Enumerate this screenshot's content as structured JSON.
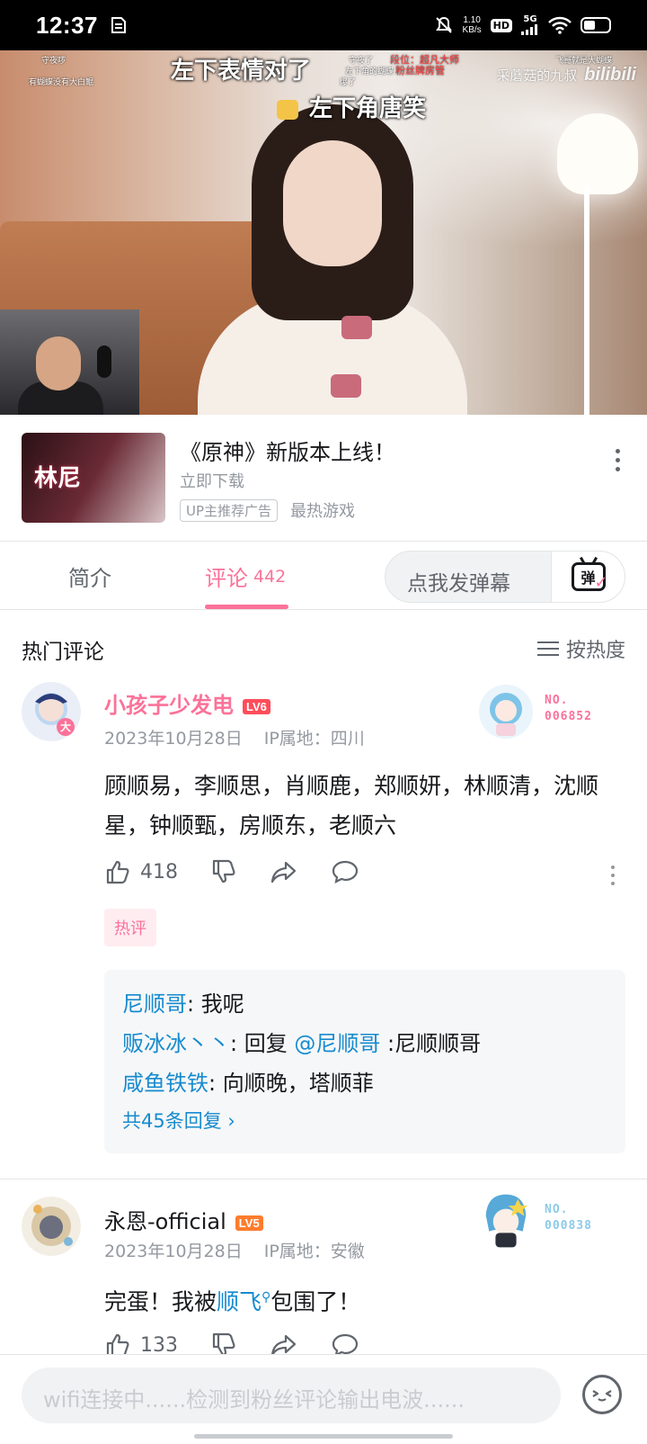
{
  "status_bar": {
    "time": "12:37",
    "net_speed_value": "1.10",
    "net_speed_unit": "KB/s",
    "hd": "HD",
    "signal": "5G"
  },
  "video": {
    "danmaku_top": "左下表情对了",
    "danmaku_second": "左下角唐笑",
    "small_danmaku": [
      "守夜啰",
      "有蝴蝶没有大白鲲",
      "守夜了",
      "段位：超凡大师",
      "左下角的蝴蝶",
      "粉丝牌房管",
      "爆了",
      "飞哥就是大蝴蝶"
    ],
    "watermark_text": "采蘑菇的九叔",
    "watermark_logo": "bilibili"
  },
  "ad": {
    "image_logo": "林尼",
    "title": "《原神》新版本上线！",
    "subtitle": "立即下载",
    "tag": "UP主推荐广告",
    "category": "最热游戏"
  },
  "tabs": {
    "intro": "简介",
    "comments": "评论",
    "comments_count": "442",
    "danmaku_placeholder": "点我发弹幕",
    "danmaku_button": "弹"
  },
  "comments_section": {
    "title": "热门评论",
    "sort": "按热度"
  },
  "comments": [
    {
      "username": "小孩子少发电",
      "level": "LV6",
      "date": "2023年10月28日",
      "ip": "IP属地：四川",
      "badge_no_label": "NO.",
      "badge_no": "006852",
      "avatar_badge": "大",
      "content": "顾顺易，李顺思，肖顺鹿，郑顺妍，林顺清，沈顺星，钟顺甄，房顺东，老顺六",
      "likes": "418",
      "hot_tag": "热评",
      "replies": [
        {
          "who": "尼顺哥",
          "sep": ":",
          "text": " 我呢"
        },
        {
          "who": "贩冰冰丶丶",
          "sep": ":",
          "pre": " 回复 ",
          "mention": "@尼顺哥",
          "text": " :尼顺顺哥"
        },
        {
          "who": "咸鱼铁铁",
          "sep": ":",
          "text": " 向顺晚，塔顺菲"
        }
      ],
      "more_replies": "共45条回复 ›"
    },
    {
      "username": "永恩-official",
      "level": "LV5",
      "date": "2023年10月28日",
      "ip": "IP属地：安徽",
      "badge_no_label": "NO.",
      "badge_no": "000838",
      "content_pre": "完蛋！我被",
      "content_link": "顺飞",
      "content_post": "包围了！",
      "likes": "133"
    }
  ],
  "bottom_bar": {
    "placeholder": "wifi连接中......检测到粉丝评论输出电波......"
  },
  "colors": {
    "accent": "#fb7299",
    "link": "#178bcf",
    "muted": "#9499a0"
  }
}
